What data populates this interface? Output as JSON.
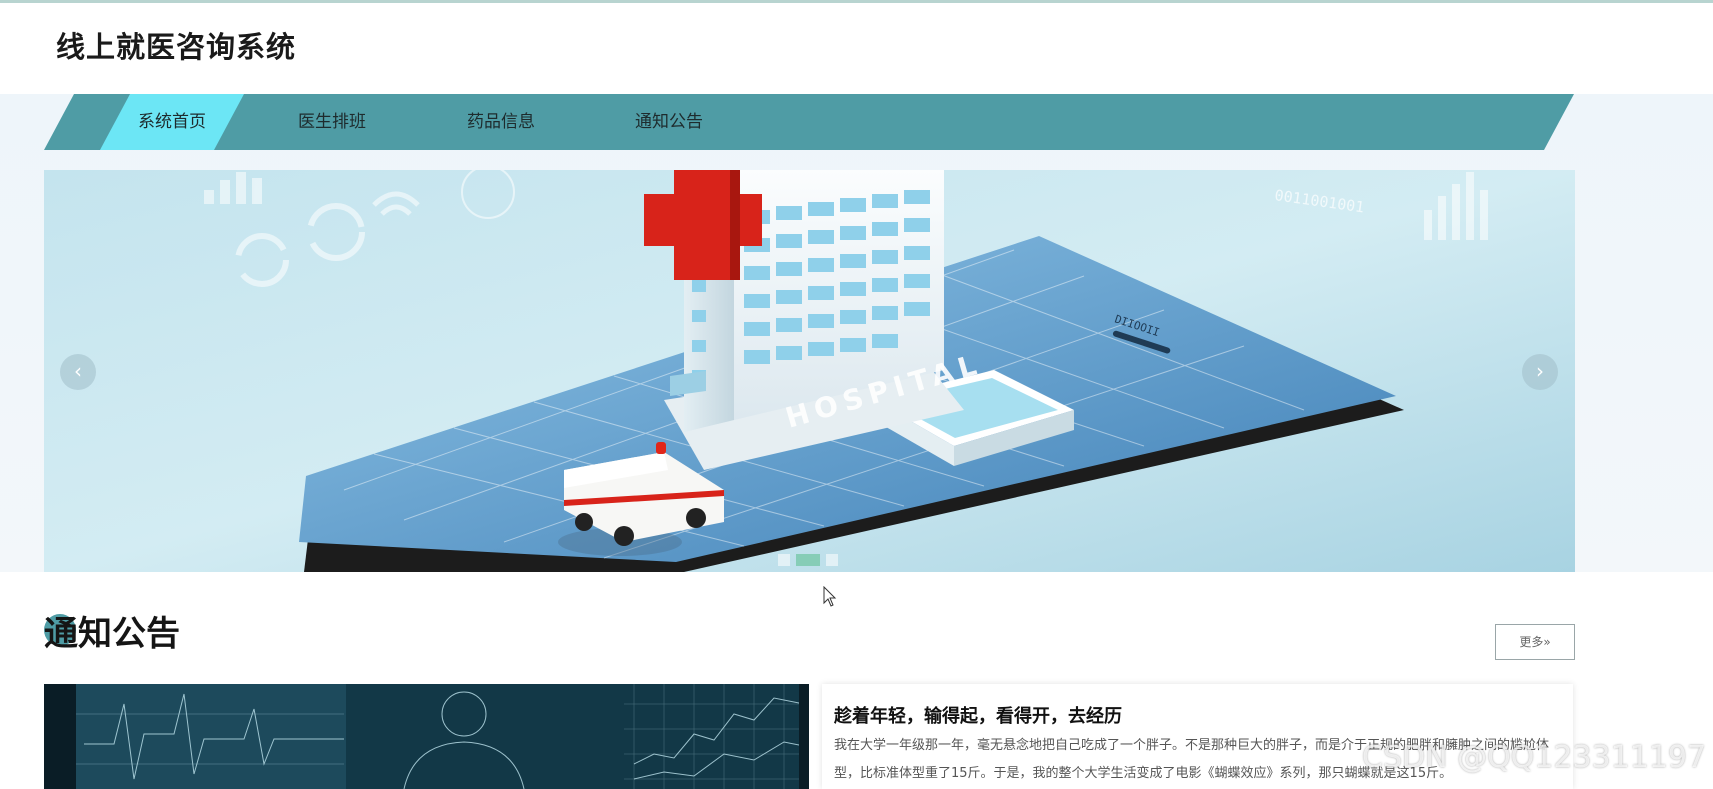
{
  "site": {
    "title": "线上就医咨询系统"
  },
  "nav": {
    "items": [
      {
        "label": "系统首页",
        "active": true
      },
      {
        "label": "医生排班",
        "active": false
      },
      {
        "label": "药品信息",
        "active": false
      },
      {
        "label": "通知公告",
        "active": false
      }
    ]
  },
  "banner": {
    "prev_icon": "chevron-left-icon",
    "next_icon": "chevron-right-icon",
    "prev_glyph": "‹",
    "next_glyph": "›",
    "slide_count": 3,
    "active_slide": 2,
    "image_text": {
      "hospital_sign": "HOSPITAL",
      "binary": "0011001001",
      "phone_code": "DIIOOII"
    }
  },
  "notice": {
    "section_title": "通知公告",
    "more_label": "更多»",
    "article": {
      "title": "趁着年轻，输得起，看得开，去经历",
      "text": "我在大学一年级那一年，毫无悬念地把自己吃成了一个胖子。不是那种巨大的胖子，而是介于正规的肥胖和臃肿之间的尴尬体型，比标准体型重了15斤。于是，我的整个大学生活变成了电影《蝴蝶效应》系列，那只蝴蝶就是这15斤。"
    }
  },
  "watermark": "CSDN @QQ123311197",
  "colors": {
    "nav_bg": "#4f9ca5",
    "nav_active": "#6ce6f5",
    "accent": "#4f9ca5"
  }
}
